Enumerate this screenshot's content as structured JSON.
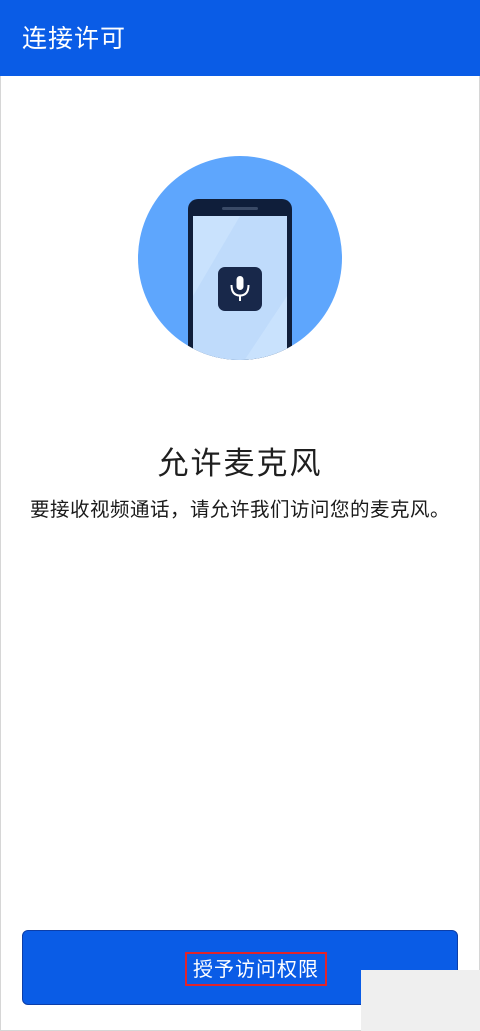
{
  "app_bar": {
    "title": "连接许可"
  },
  "illustration": {
    "icon": "microphone-icon",
    "circle_color": "#5ea6fd",
    "phone_color": "#0f1e3a",
    "screen_color": "#c9e2fd"
  },
  "permission": {
    "title": "允许麦克风",
    "description": "要接收视频通话，请允许我们访问您的麦克风。"
  },
  "action": {
    "grant_label": "授予访问权限"
  },
  "colors": {
    "brand": "#0a5ce6",
    "highlight_box": "#e0242a"
  }
}
